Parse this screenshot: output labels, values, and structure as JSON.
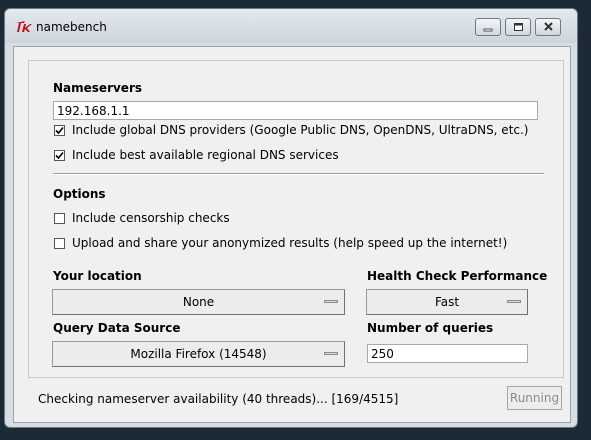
{
  "window": {
    "title": "namebench",
    "app_icon": "tk-feather-icon"
  },
  "nameservers": {
    "heading": "Nameservers",
    "input_value": "192.168.1.1",
    "options": [
      {
        "label": "Include global DNS providers (Google Public DNS, OpenDNS, UltraDNS, etc.)",
        "checked": true
      },
      {
        "label": "Include best available regional DNS services",
        "checked": true
      }
    ]
  },
  "options": {
    "heading": "Options",
    "items": [
      {
        "label": "Include censorship checks",
        "checked": false
      },
      {
        "label": "Upload and share your anonymized results (help speed up the internet!)",
        "checked": false
      }
    ]
  },
  "location": {
    "heading": "Your location",
    "value": "None"
  },
  "health_check": {
    "heading": "Health Check Performance",
    "value": "Fast"
  },
  "query_source": {
    "heading": "Query Data Source",
    "value": "Mozilla Firefox (14548)"
  },
  "num_queries": {
    "heading": "Number of queries",
    "value": "250"
  },
  "status": {
    "text": "Checking nameserver availability (40 threads)... [169/4515]"
  },
  "run_button": {
    "label": "Running",
    "enabled": false
  }
}
